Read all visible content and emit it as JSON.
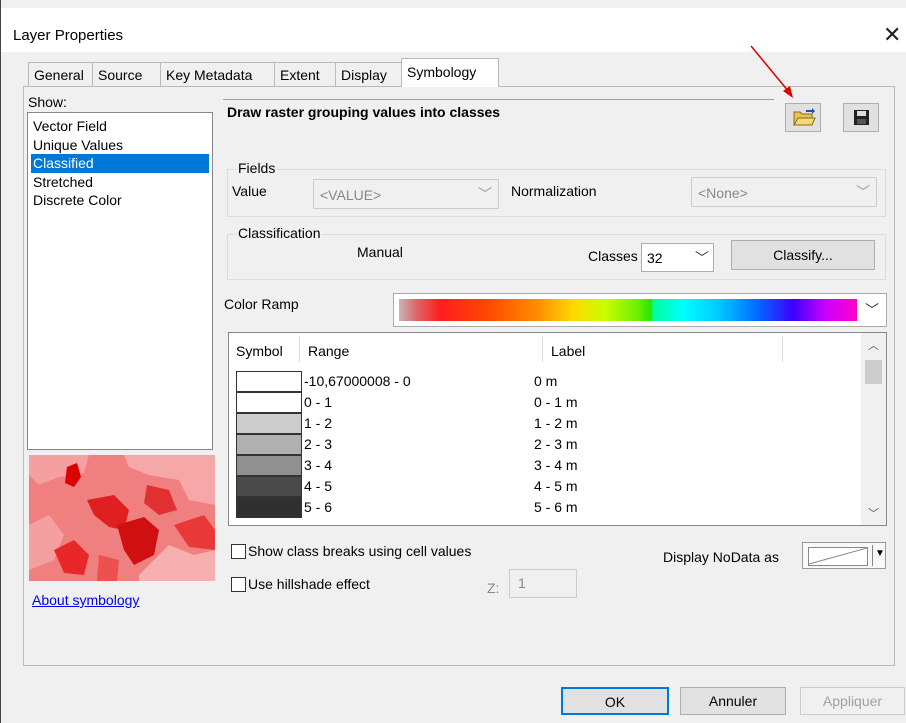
{
  "window": {
    "title": "Layer Properties",
    "close_glyph": "✕"
  },
  "tabs": [
    {
      "label": "General"
    },
    {
      "label": "Source"
    },
    {
      "label": "Key Metadata"
    },
    {
      "label": "Extent"
    },
    {
      "label": "Display"
    },
    {
      "label": "Symbology"
    }
  ],
  "show": {
    "label": "Show:",
    "items": [
      "Vector Field",
      "Unique Values",
      "Classified",
      "Stretched",
      "Discrete Color"
    ],
    "selected": "Classified"
  },
  "about_link": "About symbology",
  "heading": "Draw raster grouping values into classes",
  "icons": {
    "open": "open-folder-icon",
    "save": "floppy-save-icon"
  },
  "fields": {
    "group_label": "Fields",
    "value_label": "Value",
    "value_selected": "<VALUE>",
    "normalization_label": "Normalization",
    "normalization_selected": "<None>"
  },
  "classification": {
    "group_label": "Classification",
    "method": "Manual",
    "classes_label": "Classes",
    "classes_value": "32",
    "classify_button": "Classify..."
  },
  "color_ramp_label": "Color Ramp",
  "table": {
    "headers": {
      "symbol": "Symbol",
      "range": "Range",
      "label": "Label"
    },
    "rows": [
      {
        "range": "-10,67000008 - 0",
        "label": "0 m",
        "color": "#ffffff"
      },
      {
        "range": "0 - 1",
        "label": "0 - 1 m",
        "color": "#ffffff"
      },
      {
        "range": "1 - 2",
        "label": "1 - 2 m",
        "color": "#cccccc"
      },
      {
        "range": "2 - 3",
        "label": "2 - 3 m",
        "color": "#b0b0b0"
      },
      {
        "range": "3 - 4",
        "label": "3 - 4 m",
        "color": "#909090"
      },
      {
        "range": "4 - 5",
        "label": "4 - 5 m",
        "color": "#4a4a4a"
      },
      {
        "range": "5 - 6",
        "label": "5 - 6 m",
        "color": "#303030"
      }
    ]
  },
  "options": {
    "show_breaks_label": "Show class breaks using cell values",
    "hillshade_label": "Use hillshade effect",
    "z_label": "Z:",
    "z_value": "1",
    "nodata_label": "Display NoData as"
  },
  "footer": {
    "ok": "OK",
    "cancel": "Annuler",
    "apply": "Appliquer"
  }
}
